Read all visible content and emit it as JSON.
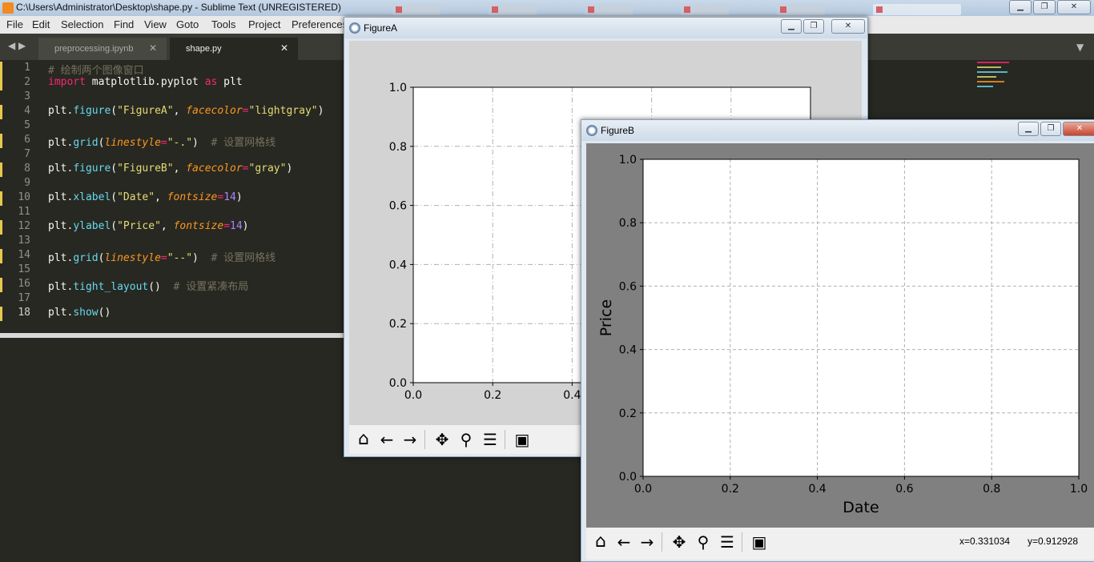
{
  "window": {
    "title": "C:\\Users\\Administrator\\Desktop\\shape.py - Sublime Text (UNREGISTERED)"
  },
  "menu": [
    "File",
    "Edit",
    "Selection",
    "Find",
    "View",
    "Goto",
    "Tools",
    "Project",
    "Preferences"
  ],
  "tabs": [
    {
      "label": "preprocessing.ipynb",
      "active": false
    },
    {
      "label": "shape.py",
      "active": true
    }
  ],
  "editor": {
    "lines": [
      {
        "n": "1",
        "tokens": [
          {
            "t": "# 绘制两个图像窗口",
            "c": "cm"
          }
        ]
      },
      {
        "n": "2",
        "tokens": [
          {
            "t": "import",
            "c": "kw"
          },
          {
            "t": " matplotlib.pyplot ",
            "c": ""
          },
          {
            "t": "as",
            "c": "kw"
          },
          {
            "t": " plt",
            "c": ""
          }
        ]
      },
      {
        "n": "3",
        "tokens": []
      },
      {
        "n": "4",
        "tokens": [
          {
            "t": "plt.",
            "c": ""
          },
          {
            "t": "figure",
            "c": "fn"
          },
          {
            "t": "(",
            "c": ""
          },
          {
            "t": "\"FigureA\"",
            "c": "st"
          },
          {
            "t": ", ",
            "c": ""
          },
          {
            "t": "facecolor",
            "c": "pa"
          },
          {
            "t": "=",
            "c": "kw"
          },
          {
            "t": "\"lightgray\"",
            "c": "st"
          },
          {
            "t": ")",
            "c": ""
          }
        ]
      },
      {
        "n": "5",
        "tokens": []
      },
      {
        "n": "6",
        "tokens": [
          {
            "t": "plt.",
            "c": ""
          },
          {
            "t": "grid",
            "c": "fn"
          },
          {
            "t": "(",
            "c": ""
          },
          {
            "t": "linestyle",
            "c": "pa"
          },
          {
            "t": "=",
            "c": "kw"
          },
          {
            "t": "\"-.\"",
            "c": "st"
          },
          {
            "t": ")  ",
            "c": ""
          },
          {
            "t": "# 设置网格线",
            "c": "cm"
          }
        ]
      },
      {
        "n": "7",
        "tokens": []
      },
      {
        "n": "8",
        "tokens": [
          {
            "t": "plt.",
            "c": ""
          },
          {
            "t": "figure",
            "c": "fn"
          },
          {
            "t": "(",
            "c": ""
          },
          {
            "t": "\"FigureB\"",
            "c": "st"
          },
          {
            "t": ", ",
            "c": ""
          },
          {
            "t": "facecolor",
            "c": "pa"
          },
          {
            "t": "=",
            "c": "kw"
          },
          {
            "t": "\"gray\"",
            "c": "st"
          },
          {
            "t": ")",
            "c": ""
          }
        ]
      },
      {
        "n": "9",
        "tokens": []
      },
      {
        "n": "10",
        "tokens": [
          {
            "t": "plt.",
            "c": ""
          },
          {
            "t": "xlabel",
            "c": "fn"
          },
          {
            "t": "(",
            "c": ""
          },
          {
            "t": "\"Date\"",
            "c": "st"
          },
          {
            "t": ", ",
            "c": ""
          },
          {
            "t": "fontsize",
            "c": "pa"
          },
          {
            "t": "=",
            "c": "kw"
          },
          {
            "t": "14",
            "c": "nu"
          },
          {
            "t": ")",
            "c": ""
          }
        ]
      },
      {
        "n": "11",
        "tokens": []
      },
      {
        "n": "12",
        "tokens": [
          {
            "t": "plt.",
            "c": ""
          },
          {
            "t": "ylabel",
            "c": "fn"
          },
          {
            "t": "(",
            "c": ""
          },
          {
            "t": "\"Price\"",
            "c": "st"
          },
          {
            "t": ", ",
            "c": ""
          },
          {
            "t": "fontsize",
            "c": "pa"
          },
          {
            "t": "=",
            "c": "kw"
          },
          {
            "t": "14",
            "c": "nu"
          },
          {
            "t": ")",
            "c": ""
          }
        ]
      },
      {
        "n": "13",
        "tokens": []
      },
      {
        "n": "14",
        "tokens": [
          {
            "t": "plt.",
            "c": ""
          },
          {
            "t": "grid",
            "c": "fn"
          },
          {
            "t": "(",
            "c": ""
          },
          {
            "t": "linestyle",
            "c": "pa"
          },
          {
            "t": "=",
            "c": "kw"
          },
          {
            "t": "\"--\"",
            "c": "st"
          },
          {
            "t": ")  ",
            "c": ""
          },
          {
            "t": "# 设置网格线",
            "c": "cm"
          }
        ]
      },
      {
        "n": "15",
        "tokens": []
      },
      {
        "n": "16",
        "tokens": [
          {
            "t": "plt.",
            "c": ""
          },
          {
            "t": "tight_layout",
            "c": "fn"
          },
          {
            "t": "()  ",
            "c": ""
          },
          {
            "t": "# 设置紧凑布局",
            "c": "cm"
          }
        ]
      },
      {
        "n": "17",
        "tokens": []
      },
      {
        "n": "18",
        "tokens": [
          {
            "t": "plt.",
            "c": ""
          },
          {
            "t": "show",
            "c": "fn"
          },
          {
            "t": "()",
            "c": ""
          }
        ]
      }
    ]
  },
  "figureA": {
    "title": "FigureA",
    "facecolor": "#d3d3d3"
  },
  "figureB": {
    "title": "FigureB",
    "facecolor": "#808080",
    "coords": {
      "x": "x=0.331034",
      "y": "y=0.912928"
    }
  },
  "toolbar_icons": [
    "home-icon",
    "back-icon",
    "forward-icon",
    "pan-icon",
    "zoom-icon",
    "configure-icon",
    "save-icon"
  ],
  "chart_data": [
    {
      "type": "line",
      "title": "FigureA",
      "series": [],
      "xlim": [
        0,
        1
      ],
      "ylim": [
        0,
        1
      ],
      "xticks": [
        "0.0",
        "0.2",
        "0.4"
      ],
      "yticks": [
        "0.0",
        "0.2",
        "0.4",
        "0.6",
        "0.8",
        "1.0"
      ],
      "grid": "dash-dot",
      "xlabel": "",
      "ylabel": ""
    },
    {
      "type": "line",
      "title": "FigureB",
      "series": [],
      "xlim": [
        0,
        1
      ],
      "ylim": [
        0,
        1
      ],
      "xticks": [
        "0.0",
        "0.2",
        "0.4",
        "0.6",
        "0.8",
        "1.0"
      ],
      "yticks": [
        "0.0",
        "0.2",
        "0.4",
        "0.6",
        "0.8",
        "1.0"
      ],
      "grid": "dashed",
      "xlabel": "Date",
      "ylabel": "Price"
    }
  ]
}
